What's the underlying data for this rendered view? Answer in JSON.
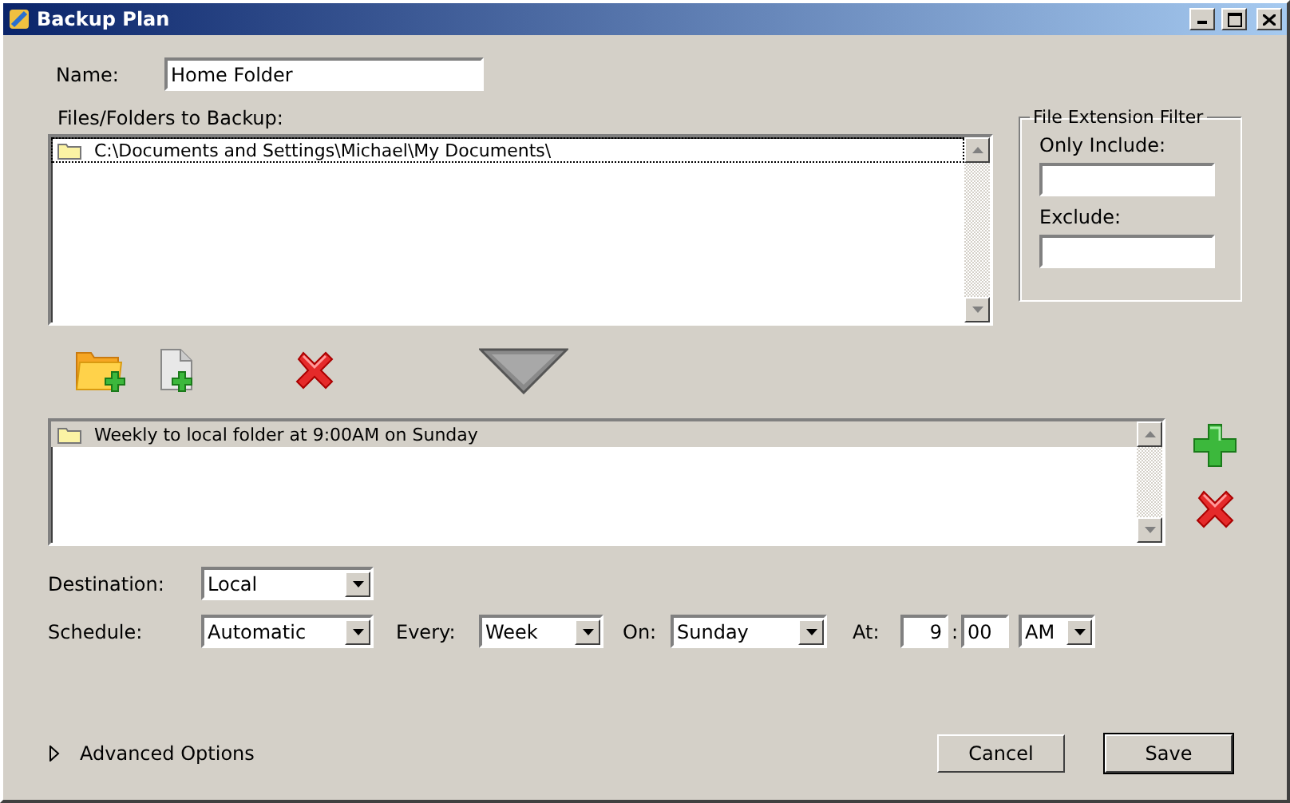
{
  "window": {
    "title": "Backup Plan"
  },
  "name": {
    "label": "Name:",
    "value": "Home Folder"
  },
  "files": {
    "label": "Files/Folders to Backup:",
    "items": [
      {
        "text": "C:\\Documents and Settings\\Michael\\My Documents\\",
        "selected": true
      }
    ]
  },
  "filter": {
    "title": "File Extension Filter",
    "fields": [
      {
        "label": "Only Include:"
      },
      {
        "label": "Exclude:"
      }
    ]
  },
  "plans": {
    "items": [
      {
        "text": "Weekly to local folder at 9:00AM on Sunday",
        "selected": true
      }
    ]
  },
  "destination": {
    "label": "Destination:",
    "value": "Local"
  },
  "schedule": {
    "label": "Schedule:",
    "value": "Automatic",
    "every": {
      "label": "Every:",
      "value": "Week"
    },
    "on": {
      "label": "On:",
      "value": "Sunday"
    },
    "at": {
      "label": "At:",
      "hour": "9",
      "separator": ":",
      "minute": "00",
      "period": "AM"
    }
  },
  "advanced": {
    "label": "Advanced Options",
    "expanded": false
  },
  "buttons": [
    {
      "label": "Cancel",
      "default": false
    },
    {
      "label": "Save",
      "default": true
    }
  ]
}
